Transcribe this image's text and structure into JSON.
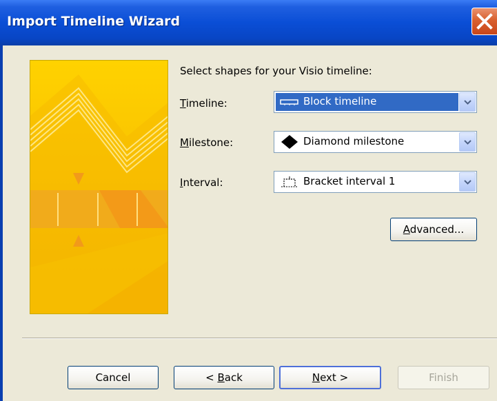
{
  "window": {
    "title": "Import Timeline Wizard",
    "close_icon": "close-icon"
  },
  "content": {
    "intro": "Select shapes for your Visio timeline:",
    "fields": [
      {
        "label_mnemonic": "T",
        "label_rest": "imeline:",
        "value": "Block timeline",
        "icon": "block-timeline-icon"
      },
      {
        "label_mnemonic": "M",
        "label_rest": "ilestone:",
        "value": "Diamond milestone",
        "icon": "diamond-milestone-icon"
      },
      {
        "label_mnemonic": "I",
        "label_rest": "nterval:",
        "value": "Bracket interval 1",
        "icon": "bracket-interval-icon"
      }
    ],
    "advanced_mnemonic": "A",
    "advanced_rest": "dvanced..."
  },
  "buttons": {
    "cancel": "Cancel",
    "back_prefix": "< ",
    "back_mnemonic": "B",
    "back_rest": "ack",
    "next_mnemonic": "N",
    "next_rest": "ext >",
    "finish": "Finish"
  },
  "colors": {
    "titlebar": "#0a4ed6",
    "dialog_bg": "#ece9d8",
    "selection": "#316ac5",
    "banner": "#f5b800"
  }
}
